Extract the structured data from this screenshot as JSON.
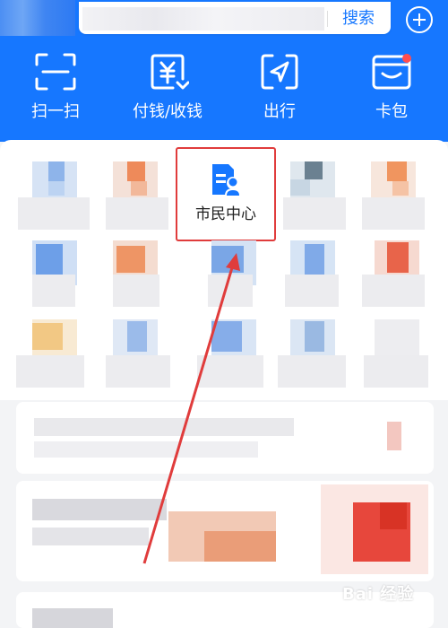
{
  "header": {
    "search_button": "搜索",
    "add_icon": "plus-circle-icon",
    "tools": [
      {
        "label": "扫一扫",
        "icon": "scan-icon"
      },
      {
        "label": "付钱/收钱",
        "icon": "payment-icon"
      },
      {
        "label": "出行",
        "icon": "travel-icon"
      },
      {
        "label": "卡包",
        "icon": "card-wallet-icon"
      }
    ]
  },
  "grid": {
    "highlighted_item": {
      "label": "市民中心",
      "icon": "citizen-center-icon"
    }
  },
  "annotation": {
    "color": "#e03c3c"
  },
  "watermark": {
    "text": "Bai 经验"
  },
  "colors": {
    "brand": "#1677ff",
    "highlight_border": "#e03c3c"
  }
}
